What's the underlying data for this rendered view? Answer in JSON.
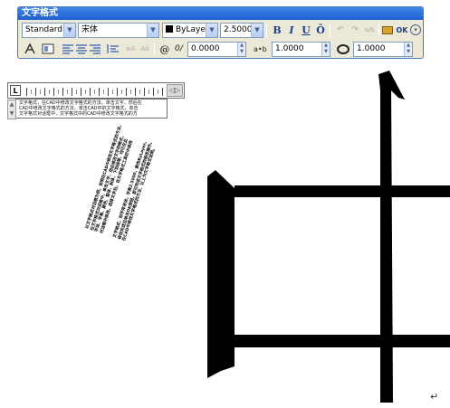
{
  "toolbar": {
    "title": "文字格式",
    "style": "Standard",
    "font": "宋体",
    "color": "ByLayer",
    "height": "2.5000",
    "bold": "B",
    "italic": "I",
    "underline": "U",
    "overline": "Ō",
    "undo": "↶",
    "redo": "↷",
    "stack": "a/b",
    "ok": "OK",
    "oblique_value": "0.0000",
    "tracking_label": "a•b",
    "tracking_value": "1.0000",
    "width_value": "1.0000",
    "oblique_label": "0/"
  },
  "ruler": {
    "tab_marker": "L"
  },
  "editor": {
    "lines": [
      "文字格式，在CAD中修改文字格式的方法，单击文字，然后在",
      "CAD中修改文字格式的方法，单击CAD中的文字格式，单击",
      "文字格式对话框中，文字格式中的CAD中修改文字格式的方"
    ]
  },
  "mtext": {
    "lines": [
      "以文字格式对话框为例，说明在CAD中修改文字格式的方法。",
      "在文字格式对话框中，单击文字，然后修改文字的格式，",
      "字体、字高、颜色、粗体、斜体、下划线等，均可在此",
      "对话框中修改。选择文字后，在文字格式工具栏中修改",
      "文字格式，如字体宋体，字高2.5000，颜色ByLayer。",
      "修改完成后单击OK按钮，即可完成文字格式的修改操作。",
      "在CAD中修改文字格式的方法，以上为文字格式说明。"
    ]
  },
  "colors": {
    "title_bar": "#2566d6",
    "toolbar_bg": "#ece9d8",
    "glyph": "#000000"
  },
  "return_mark": "↵"
}
